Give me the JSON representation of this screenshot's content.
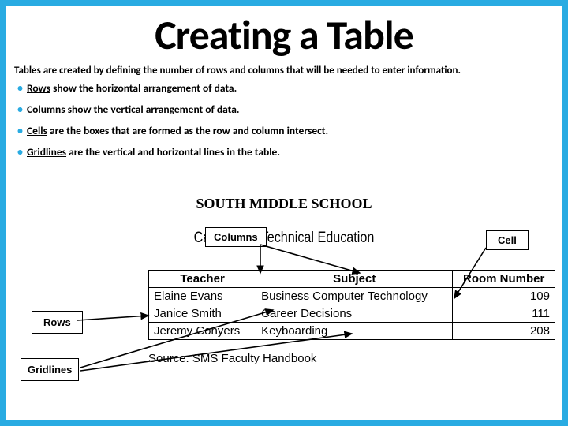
{
  "title": "Creating a Table",
  "intro": "Tables are created by defining the number of rows and columns that will be needed to enter information.",
  "defs": {
    "rows": {
      "term": "Rows",
      "rest": " show the horizontal arrangement of data."
    },
    "columns": {
      "term": "Columns",
      "rest": " show the vertical arrangement of data."
    },
    "cells": {
      "term": "Cells",
      "rest": " are the boxes that are formed as the row and column intersect."
    },
    "gridlines": {
      "term": "Gridlines",
      "rest": " are the vertical and horizontal lines in the table."
    }
  },
  "figure": {
    "school": "SOUTH MIDDLE SCHOOL",
    "program": "Career and Technical Education",
    "labels": {
      "columns": "Columns",
      "cell": "Cell",
      "rows": "Rows",
      "gridlines": "Gridlines"
    },
    "headers": {
      "c1": "Teacher",
      "c2": "Subject",
      "c3": "Room Number"
    },
    "rows": [
      {
        "teacher": "Elaine Evans",
        "subject": "Business Computer Technology",
        "room": "109"
      },
      {
        "teacher": "Janice Smith",
        "subject": "Career Decisions",
        "room": "111"
      },
      {
        "teacher": "Jeremy Conyers",
        "subject": "Keyboarding",
        "room": "208"
      }
    ],
    "source": "Source:  SMS Faculty Handbook"
  }
}
